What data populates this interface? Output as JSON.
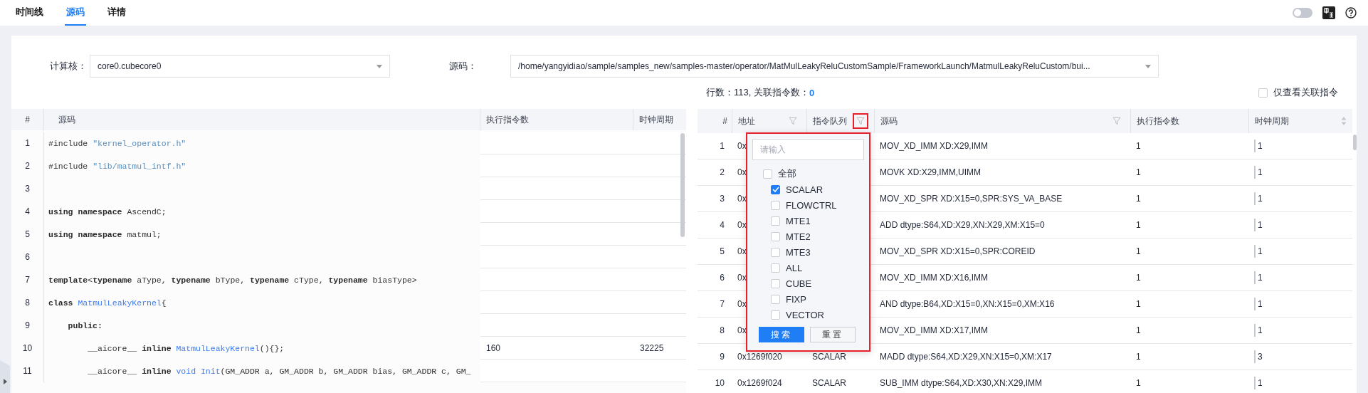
{
  "tabs": [
    {
      "label": "时间线",
      "selected": false
    },
    {
      "label": "源码",
      "selected": true
    },
    {
      "label": "详情",
      "selected": false
    }
  ],
  "header_controls": {
    "toggle": {
      "on": false
    }
  },
  "selectors": [
    {
      "label": "计算核：",
      "value": "core0.cubecore0",
      "kind": "short"
    },
    {
      "label": "源码：",
      "value": "/home/yangyidiao/sample/samples_new/samples-master/operator/MatMulLeakyReluCustomSample/FrameworkLaunch/MatmulLeakyReluCustom/bui...",
      "kind": "long"
    }
  ],
  "summary": {
    "text": "行数：113, 关联指令数：",
    "count": "0"
  },
  "related_only": {
    "label": "仅查看关联指令",
    "checked": false
  },
  "source_table": {
    "columns": [
      "#",
      "源码",
      "执行指令数",
      "时钟周期"
    ],
    "rows": [
      {
        "line": "1",
        "code": [
          {
            "kind": "plain",
            "text": "#include "
          },
          {
            "kind": "string",
            "text": "\"kernel_operator.h\""
          }
        ]
      },
      {
        "line": "2",
        "code": [
          {
            "kind": "plain",
            "text": "#include "
          },
          {
            "kind": "string",
            "text": "\"lib/matmul_intf.h\""
          }
        ]
      },
      {
        "line": "3"
      },
      {
        "line": "4",
        "code": [
          {
            "kind": "keyword",
            "text": "using namespace"
          },
          {
            "kind": "plain",
            "text": " AscendC;"
          }
        ]
      },
      {
        "line": "5",
        "code": [
          {
            "kind": "keyword",
            "text": "using namespace"
          },
          {
            "kind": "plain",
            "text": " matmul;"
          }
        ]
      },
      {
        "line": "6"
      },
      {
        "line": "7",
        "code": [
          {
            "kind": "keyword",
            "text": "template"
          },
          {
            "kind": "plain",
            "text": "<"
          },
          {
            "kind": "keyword",
            "text": "typename"
          },
          {
            "kind": "plain",
            "text": " aType, "
          },
          {
            "kind": "keyword",
            "text": "typename"
          },
          {
            "kind": "plain",
            "text": " bType, "
          },
          {
            "kind": "keyword",
            "text": "typename"
          },
          {
            "kind": "plain",
            "text": " cType, "
          },
          {
            "kind": "keyword",
            "text": "typename"
          },
          {
            "kind": "plain",
            "text": " biasType>"
          }
        ]
      },
      {
        "line": "8",
        "code": [
          {
            "kind": "keyword",
            "text": "class "
          },
          {
            "kind": "name",
            "text": "MatmulLeakyKernel"
          },
          {
            "kind": "plain",
            "text": "{"
          }
        ]
      },
      {
        "line": "9",
        "code": [
          {
            "kind": "keyword",
            "text": "    public:"
          }
        ]
      },
      {
        "line": "10",
        "code": [
          {
            "kind": "plain",
            "text": "        __aicore__ "
          },
          {
            "kind": "keyword",
            "text": "inline "
          },
          {
            "kind": "name",
            "text": "MatmulLeakyKernel"
          },
          {
            "kind": "plain",
            "text": "(){};"
          }
        ],
        "instructions": "160",
        "cycles": "32225"
      },
      {
        "line": "11",
        "code": [
          {
            "kind": "plain",
            "text": "        __aicore__ "
          },
          {
            "kind": "keyword",
            "text": "inline "
          },
          {
            "kind": "name",
            "text": "void Init"
          },
          {
            "kind": "plain",
            "text": "(GM_ADDR a, GM_ADDR b, GM_ADDR bias, GM_ADDR c, GM_"
          }
        ]
      }
    ]
  },
  "instruction_table": {
    "columns": [
      {
        "label": "#"
      },
      {
        "label": "地址",
        "filter": true,
        "highlighted": false
      },
      {
        "label": "指令队列",
        "filter": true,
        "highlighted": true
      },
      {
        "label": "源码",
        "filter": true,
        "highlighted": false
      },
      {
        "label": "执行指令数"
      },
      {
        "label": "时钟周期",
        "sortable": true
      }
    ],
    "rows": [
      {
        "index": "1",
        "address": "0x",
        "source": "MOV_XD_IMM XD:X29,IMM",
        "instructions": "1",
        "cycles": "1"
      },
      {
        "index": "2",
        "address": "0x",
        "source": "MOVK XD:X29,IMM,UIMM",
        "instructions": "1",
        "cycles": "1"
      },
      {
        "index": "3",
        "address": "0x",
        "source": "MOV_XD_SPR XD:X15=0,SPR:SYS_VA_BASE",
        "instructions": "1",
        "cycles": "1"
      },
      {
        "index": "4",
        "address": "0x",
        "source": "ADD dtype:S64,XD:X29,XN:X29,XM:X15=0",
        "instructions": "1",
        "cycles": "1"
      },
      {
        "index": "5",
        "address": "0x",
        "source": "MOV_XD_SPR XD:X15=0,SPR:COREID",
        "instructions": "1",
        "cycles": "1"
      },
      {
        "index": "6",
        "address": "0x",
        "source": "MOV_XD_IMM XD:X16,IMM",
        "instructions": "1",
        "cycles": "1"
      },
      {
        "index": "7",
        "address": "0x",
        "source": "AND dtype:B64,XD:X15=0,XN:X15=0,XM:X16",
        "instructions": "1",
        "cycles": "1"
      },
      {
        "index": "8",
        "address": "0x",
        "source": "MOV_XD_IMM XD:X17,IMM",
        "instructions": "1",
        "cycles": "1"
      },
      {
        "index": "9",
        "address": "0x1269f020",
        "queue": "SCALAR",
        "source": "MADD dtype:S64,XD:X29,XN:X15=0,XM:X17",
        "instructions": "1",
        "cycles": "3"
      },
      {
        "index": "10",
        "address": "0x1269f024",
        "queue": "SCALAR",
        "source": "SUB_IMM dtype:S64,XD:X30,XN:X29,IMM",
        "instructions": "1",
        "cycles": "1"
      }
    ]
  },
  "queue_filter": {
    "placeholder": "请输入",
    "options": [
      {
        "label": "全部",
        "checked": false,
        "children": [
          {
            "label": "SCALAR",
            "checked": true
          },
          {
            "label": "FLOWCTRL",
            "checked": false
          },
          {
            "label": "MTE1",
            "checked": false
          },
          {
            "label": "MTE2",
            "checked": false
          },
          {
            "label": "MTE3",
            "checked": false
          },
          {
            "label": "ALL",
            "checked": false
          },
          {
            "label": "CUBE",
            "checked": false
          },
          {
            "label": "FIXP",
            "checked": false
          },
          {
            "label": "VECTOR",
            "checked": false
          }
        ]
      }
    ],
    "buttons": [
      {
        "label": "搜索",
        "kind": "primary"
      },
      {
        "label": "重置",
        "kind": "default"
      }
    ]
  }
}
